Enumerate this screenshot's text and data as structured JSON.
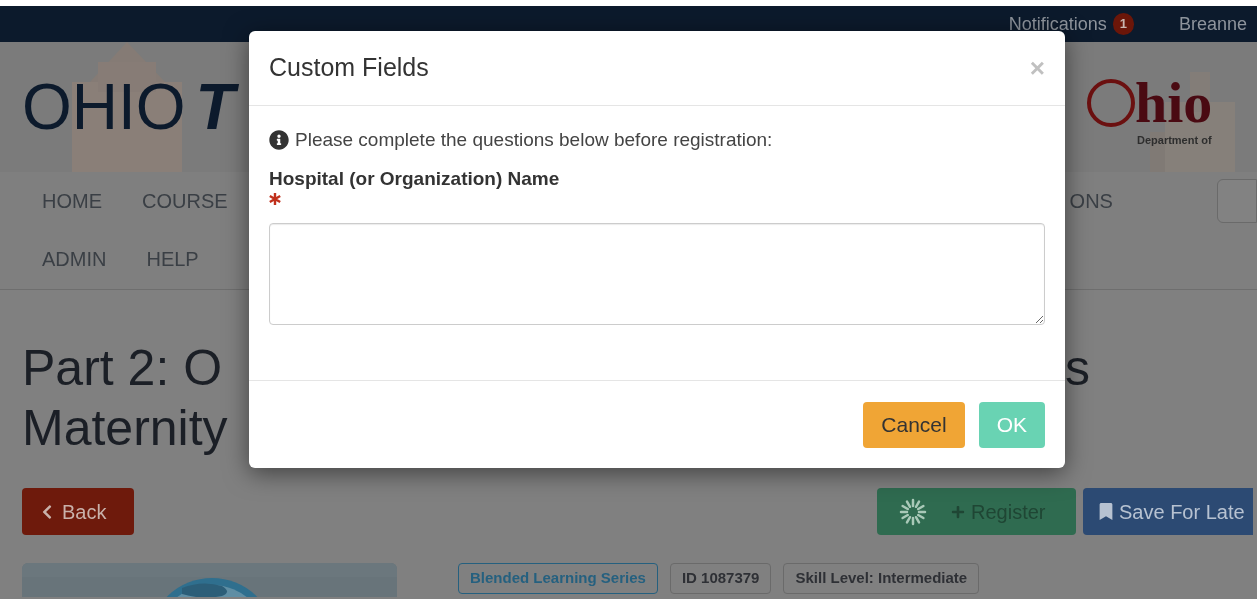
{
  "top_bar": {
    "notifications_label": "Notifications",
    "notifications_count": "1",
    "user": "Breanne"
  },
  "header": {
    "logo_left": {
      "plain": "OHIO",
      "bold": "T"
    },
    "logo_right": {
      "rest": "hio",
      "subtitle": "Department of"
    }
  },
  "nav": {
    "row_1": [
      "HOME",
      "COURSE"
    ],
    "row_1_end": "ONS",
    "row_2": [
      "ADMIN",
      "HELP"
    ]
  },
  "course": {
    "title_lines": [
      "Part 2: O",
      "Maternity"
    ],
    "title_end": "s",
    "back_button": "Back",
    "register_button": "Register",
    "save_button": "Save For Late",
    "tags": [
      {
        "label": "Blended Learning Series",
        "kind": "series"
      },
      {
        "label": "ID 1087379",
        "kind": "plain"
      },
      {
        "label": "Skill Level: Intermediate",
        "kind": "plain"
      }
    ]
  },
  "modal": {
    "title": "Custom Fields",
    "close": "×",
    "info": "Please complete the questions below before registration:",
    "field": {
      "label": "Hospital (or Organization) Name",
      "required": true
    },
    "buttons": [
      {
        "label": "Cancel",
        "kind": "cancel",
        "disabled": false
      },
      {
        "label": "OK",
        "kind": "ok",
        "disabled": true
      }
    ]
  }
}
